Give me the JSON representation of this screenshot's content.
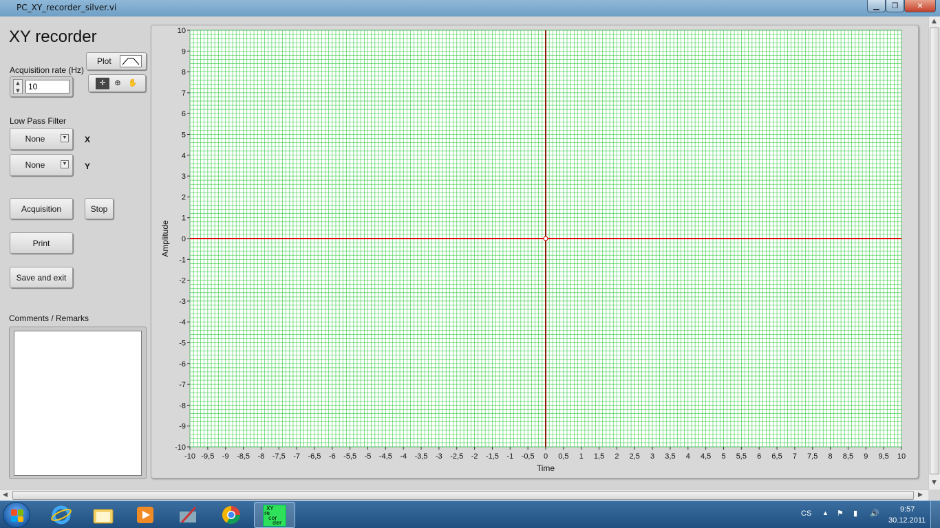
{
  "window": {
    "title": "PC_XY_recorder_silver.vi",
    "min_glyph": "▁",
    "max_glyph": "❐",
    "close_glyph": "✕"
  },
  "panel": {
    "app_title": "XY recorder",
    "acq_rate_label": "Acquisition rate (Hz)",
    "acq_rate_value": "10",
    "lpf_label": "Low Pass Filter",
    "filter_x_value": "None",
    "filter_x_label": "X",
    "filter_y_value": "None",
    "filter_y_label": "Y",
    "acquisition_btn": "Acquisition",
    "stop_btn": "Stop",
    "print_btn": "Print",
    "save_exit_btn": "Save and exit",
    "comments_label": "Comments  / Remarks",
    "plot_legend_label": "Plot"
  },
  "chart_data": {
    "type": "line",
    "title": "",
    "xlabel": "Time",
    "ylabel": "Amplitude",
    "xlim": [
      -10,
      10
    ],
    "ylim": [
      -10,
      10
    ],
    "x_ticks": [
      "-10",
      "-9,5",
      "-9",
      "-8,5",
      "-8",
      "-7,5",
      "-7",
      "-6,5",
      "-6",
      "-5,5",
      "-5",
      "-4,5",
      "-4",
      "-3,5",
      "-3",
      "-2,5",
      "-2",
      "-1,5",
      "-1",
      "-0,5",
      "0",
      "0,5",
      "1",
      "1,5",
      "2",
      "2,5",
      "3",
      "3,5",
      "4",
      "4,5",
      "5",
      "5,5",
      "6",
      "6,5",
      "7",
      "7,5",
      "8",
      "8,5",
      "9",
      "9,5",
      "10"
    ],
    "y_ticks": [
      "10",
      "9",
      "8",
      "7",
      "6",
      "5",
      "4",
      "3",
      "2",
      "1",
      "0",
      "-1",
      "-2",
      "-3",
      "-4",
      "-5",
      "-6",
      "-7",
      "-8",
      "-9",
      "-10"
    ],
    "grid": true,
    "grid_color": "#2ecc40",
    "cursor_color": "#e00000",
    "cursor": {
      "x": 0,
      "y": 0
    },
    "series": []
  },
  "taskbar": {
    "lang": "CS",
    "time": "9:57",
    "date": "30.12.2011",
    "active_app_label_1": "XY",
    "active_app_label_2": "re",
    "active_app_label_3": "cor",
    "active_app_label_4": "der"
  }
}
